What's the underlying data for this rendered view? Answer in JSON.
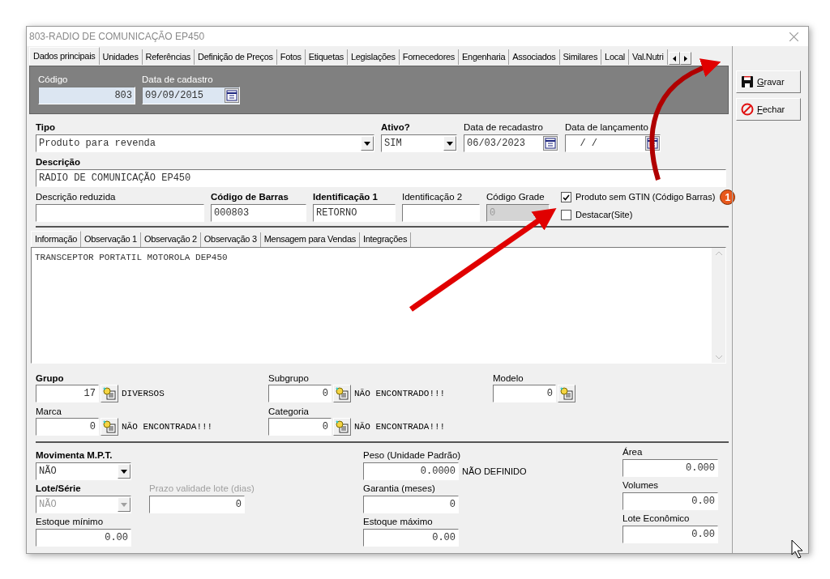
{
  "window": {
    "title": "803-RADIO DE COMUNICAÇÃO EP450"
  },
  "tabs": [
    {
      "label": "Dados principais",
      "selected": true
    },
    {
      "label": "Unidades",
      "selected": false
    },
    {
      "label": "Referências",
      "selected": false
    },
    {
      "label": "Definição de Preços",
      "selected": false
    },
    {
      "label": "Fotos",
      "selected": false
    },
    {
      "label": "Etiquetas",
      "selected": false
    },
    {
      "label": "Legislações",
      "selected": false
    },
    {
      "label": "Fornecedores",
      "selected": false
    },
    {
      "label": "Engenharia",
      "selected": false
    },
    {
      "label": "Associados",
      "selected": false
    },
    {
      "label": "Similares",
      "selected": false
    },
    {
      "label": "Local",
      "selected": false
    },
    {
      "label": "Val.Nutri",
      "selected": false
    }
  ],
  "actions": [
    {
      "kind": "save",
      "label": "Gravar"
    },
    {
      "kind": "close",
      "label": "Fechar"
    }
  ],
  "header": {
    "codigo": {
      "label": "Código",
      "value": "803"
    },
    "data_cadastro": {
      "label": "Data de cadastro",
      "value": "09/09/2015"
    }
  },
  "tipo": {
    "label": "Tipo",
    "value": "Produto para revenda",
    "required": true
  },
  "ativo": {
    "label": "Ativo?",
    "value": "SIM",
    "required": true
  },
  "data_recadastro": {
    "label": "Data de recadastro",
    "value": "06/03/2023",
    "required": false
  },
  "data_lancamento": {
    "label": "Data de lançamento",
    "value": "/ /",
    "required": false
  },
  "descricao": {
    "label": "Descrição",
    "value": "RADIO DE COMUNICAÇÃO EP450",
    "required": true
  },
  "id_fields": [
    {
      "label": "Descrição reduzida",
      "required": false
    },
    {
      "label": "Código de Barras",
      "value": "000803",
      "required": true
    },
    {
      "label": "Identificação 1",
      "value": "RETORNO",
      "required": true
    },
    {
      "label": "Identificação 2",
      "required": false
    },
    {
      "label": "Código Grade",
      "value": "0",
      "required": false,
      "disabled": true
    }
  ],
  "checkboxes": [
    {
      "label": "Produto sem GTIN (Código Barras)",
      "checked": true
    },
    {
      "label": "Destacar(Site)",
      "checked": false
    }
  ],
  "step_badge": "1",
  "subtabs": [
    {
      "label": "Informação",
      "selected": true
    },
    {
      "label": "Observação 1",
      "selected": false
    },
    {
      "label": "Observação 2",
      "selected": false
    },
    {
      "label": "Observação 3",
      "selected": false
    },
    {
      "label": "Mensagem para Vendas",
      "selected": false
    },
    {
      "label": "Integrações",
      "selected": false
    }
  ],
  "memo": {
    "value": "TRANSCEPTOR PORTATIL MOTOROLA DEP450"
  },
  "lookups": [
    {
      "label": "Grupo",
      "value": "17",
      "result": "DIVERSOS",
      "required": true
    },
    {
      "label": "Subgrupo",
      "value": "0",
      "result": "NÃO ENCONTRADO!!!",
      "required": false
    },
    {
      "label": "Modelo",
      "value": "0",
      "required": false
    },
    {
      "label": "Marca",
      "value": "0",
      "result": "NÃO ENCONTRADA!!!",
      "required": false
    },
    {
      "label": "Categoria",
      "value": "0",
      "result": "NÃO ENCONTRADA!!!",
      "required": false
    }
  ],
  "stock": {
    "movimenta": {
      "label": "Movimenta M.P.T.",
      "value": "NÃO",
      "required": true
    },
    "peso": {
      "label": "Peso (Unidade Padrão)",
      "value": "0.0000",
      "note": "NÃO DEFINIDO",
      "required": false
    },
    "area": {
      "label": "Área",
      "value": "0.000",
      "required": false
    },
    "lote_serie": {
      "label": "Lote/Série",
      "value": "NÃO",
      "required": true,
      "disabled": true
    },
    "prazo_validade": {
      "label": "Prazo validade lote (dias)",
      "value": "0",
      "required": false,
      "disabled": true
    },
    "garantia": {
      "label": "Garantia (meses)",
      "value": "0",
      "required": false
    },
    "volumes": {
      "label": "Volumes",
      "value": "0.00",
      "required": false
    },
    "estoque_minimo": {
      "label": "Estoque mínimo",
      "value": "0.00",
      "required": false
    },
    "estoque_maximo": {
      "label": "Estoque máximo",
      "value": "0.00",
      "required": false
    },
    "lote_economico": {
      "label": "Lote Econômico",
      "value": "0.00",
      "required": false
    }
  }
}
